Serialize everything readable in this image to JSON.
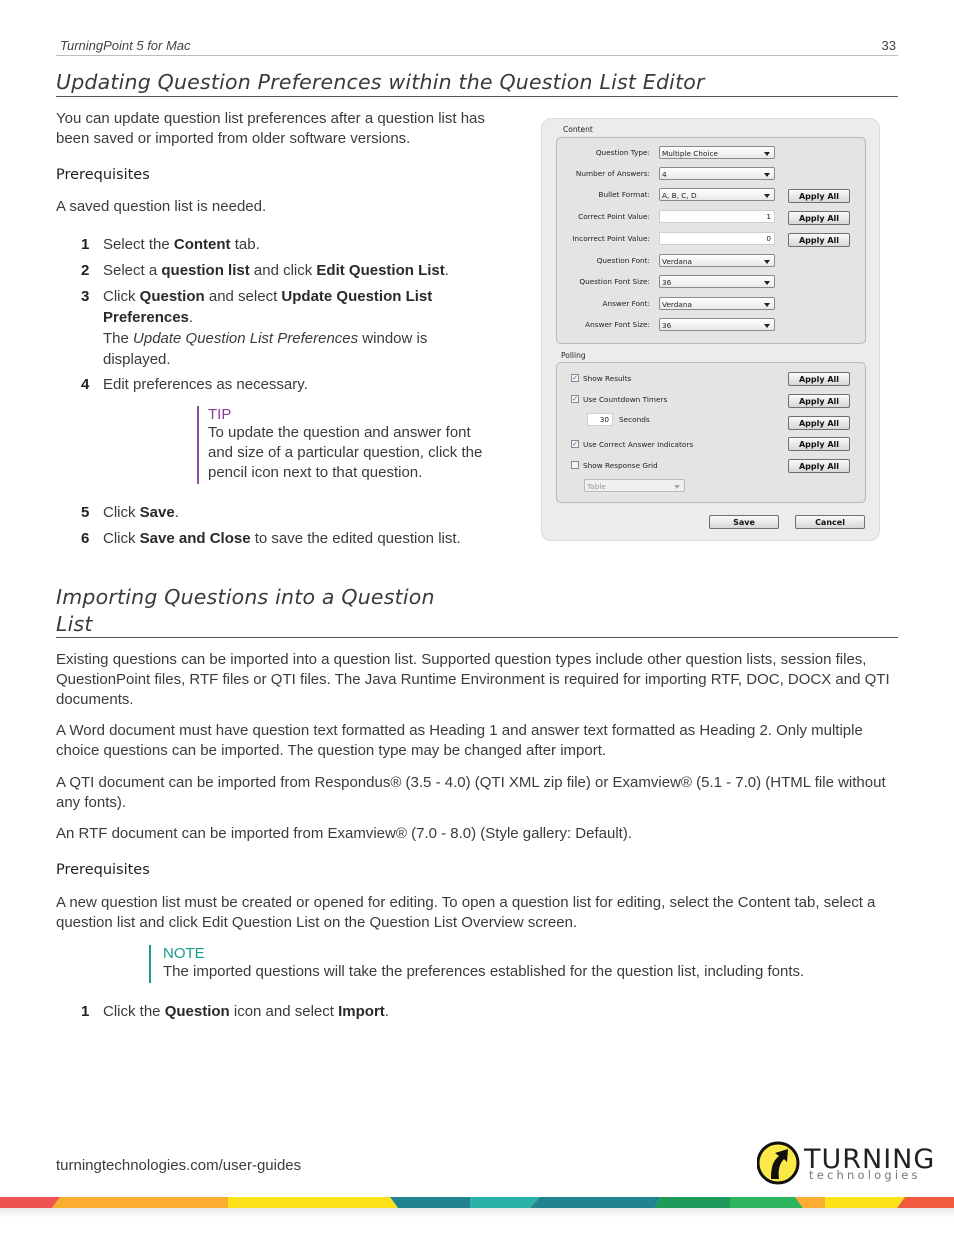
{
  "header": {
    "doc_title": "TurningPoint 5 for Mac",
    "page_number": "33"
  },
  "section1": {
    "title": "Updating Question Preferences within the Question List Editor",
    "intro": "You can update question list preferences after a question list has been saved or imported from older software versions.",
    "prereq_heading": "Prerequisites",
    "prereq_text": "A saved question list is needed.",
    "steps": [
      {
        "num": "1",
        "parts": [
          {
            "t": "Select the "
          },
          {
            "t": "Content",
            "b": true
          },
          {
            "t": " tab."
          }
        ]
      },
      {
        "num": "2",
        "parts": [
          {
            "t": "Select a "
          },
          {
            "t": "question list",
            "b": true
          },
          {
            "t": " and click "
          },
          {
            "t": "Edit Question List",
            "b": true
          },
          {
            "t": "."
          }
        ]
      },
      {
        "num": "3",
        "parts": [
          {
            "t": "Click "
          },
          {
            "t": "Question",
            "b": true
          },
          {
            "t": " and select "
          },
          {
            "t": "Update Question List Preferences",
            "b": true
          },
          {
            "t": "."
          }
        ],
        "extra": [
          {
            "t": "The "
          },
          {
            "t": "Update Question List Preferences",
            "i": true
          },
          {
            "t": " window is displayed."
          }
        ]
      },
      {
        "num": "4",
        "parts": [
          {
            "t": "Edit preferences as necessary."
          }
        ]
      },
      {
        "num": "5",
        "parts": [
          {
            "t": "Click "
          },
          {
            "t": "Save",
            "b": true
          },
          {
            "t": "."
          }
        ]
      },
      {
        "num": "6",
        "parts": [
          {
            "t": "Click "
          },
          {
            "t": "Save and Close",
            "b": true
          },
          {
            "t": " to save the edited question list."
          }
        ]
      }
    ],
    "tip": {
      "label": "TIP",
      "text": "To update the question and answer font and size of a particular question, click the pencil icon next to that question."
    }
  },
  "dialog": {
    "content_label": "Content",
    "fields": [
      {
        "label": "Question Type:",
        "type": "select",
        "value": "Multiple Choice",
        "apply": false
      },
      {
        "label": "Number of Answers:",
        "type": "select",
        "value": "4",
        "apply": false
      },
      {
        "label": "Bullet Format:",
        "type": "select",
        "value": "A, B, C, D",
        "apply": true
      },
      {
        "label": "Correct Point Value:",
        "type": "text",
        "value": "1",
        "apply": true
      },
      {
        "label": "Incorrect Point Value:",
        "type": "text",
        "value": "0",
        "apply": true
      },
      {
        "label": "Question Font:",
        "type": "select",
        "value": "Verdana",
        "apply": false
      },
      {
        "label": "Question Font Size:",
        "type": "select",
        "value": "36",
        "apply": false
      },
      {
        "label": "Answer Font:",
        "type": "select",
        "value": "Verdana",
        "apply": false
      },
      {
        "label": "Answer Font Size:",
        "type": "select",
        "value": "36",
        "apply": false
      }
    ],
    "polling_label": "Polling",
    "polling": {
      "show_results": {
        "label": "Show Results",
        "checked": true
      },
      "countdown": {
        "label": "Use Countdown Timers",
        "checked": true
      },
      "seconds_value": "30",
      "seconds_label": "Seconds",
      "correct_indicators": {
        "label": "Use Correct Answer Indicators",
        "checked": true
      },
      "response_grid": {
        "label": "Show Response Grid",
        "checked": false
      },
      "grid_select_value": "Table"
    },
    "apply_all_label": "Apply All",
    "save_label": "Save",
    "cancel_label": "Cancel",
    "check_glyph": "✓"
  },
  "section2": {
    "title_line1": "Importing Questions into a Question",
    "title_line2": "List",
    "paragraphs": [
      "Existing questions can be imported into a question list. Supported question types include other question lists, session files, QuestionPoint files, RTF files or QTI files. The Java Runtime Environment is required for importing RTF, DOC, DOCX and QTI documents.",
      "A Word document must have question text formatted as Heading 1 and answer text formatted as Heading 2. Only multiple choice questions can be imported. The question type may be changed after import.",
      "A QTI document can be imported from Respondus® (3.5 - 4.0) (QTI XML zip file) or Examview® (5.1 - 7.0) (HTML file without any fonts).",
      "An RTF document can be imported from Examview® (7.0 - 8.0) (Style gallery: Default)."
    ],
    "prereq_heading": "Prerequisites",
    "prereq_text": "A new question list must be created or opened for editing. To open a question list for editing, select the Content tab, select a question list and click Edit Question List on the Question List Overview screen.",
    "note": {
      "label": "NOTE",
      "text": "The imported questions will take the preferences established for the question list, including fonts."
    },
    "step1": {
      "num": "1",
      "parts": [
        {
          "t": "Click the "
        },
        {
          "t": "Question",
          "b": true
        },
        {
          "t": " icon and select "
        },
        {
          "t": "Import",
          "b": true
        },
        {
          "t": "."
        }
      ]
    }
  },
  "footer": {
    "link": "turningtechnologies.com/user-guides",
    "logo_word": "TURNING",
    "logo_sub": "technologies",
    "colors": {
      "tip": "#8e3e98",
      "note": "#1a9a8e"
    }
  }
}
